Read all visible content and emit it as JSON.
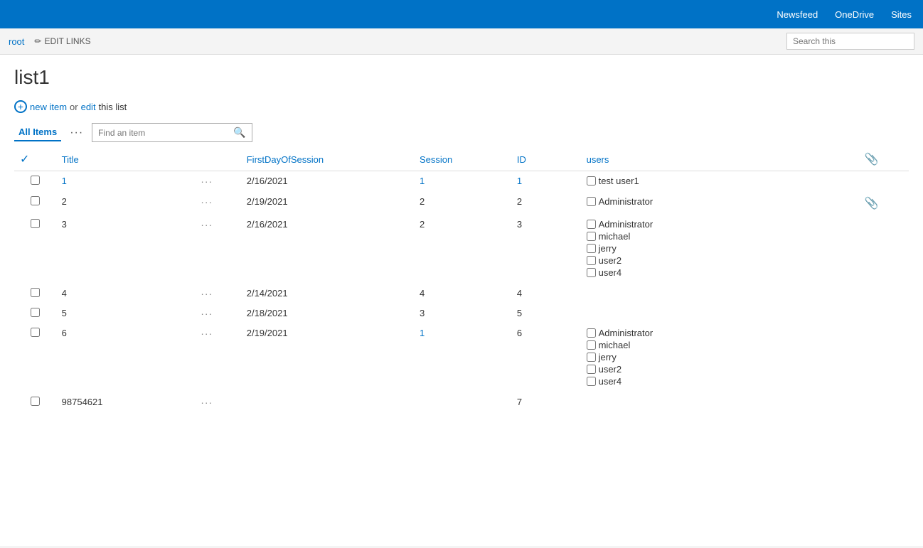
{
  "topnav": {
    "links": [
      "Newsfeed",
      "OneDrive",
      "Sites"
    ]
  },
  "subnav": {
    "breadcrumb": "root",
    "edit_links_label": "EDIT LINKS",
    "search_placeholder": "Search this"
  },
  "page": {
    "title": "list1",
    "new_item_label": "new item",
    "or_text": "or",
    "edit_label": "edit",
    "this_list_text": "this list"
  },
  "toolbar": {
    "all_items_label": "All Items",
    "ellipsis": "···",
    "find_placeholder": "Find an item",
    "search_icon": "🔍"
  },
  "table": {
    "columns": [
      "",
      "Title",
      "",
      "FirstDayOfSession",
      "Session",
      "ID",
      "users",
      "📎"
    ],
    "rows": [
      {
        "id": "1",
        "title": "1",
        "title_link": true,
        "dots": "···",
        "date": "2/16/2021",
        "session": "1",
        "session_link": true,
        "rowid": "1",
        "rowid_link": true,
        "users": [
          {
            "name": "test user1",
            "checked": false
          }
        ],
        "attach": false
      },
      {
        "id": "2",
        "title": "2",
        "title_link": false,
        "dots": "···",
        "date": "2/19/2021",
        "session": "2",
        "session_link": false,
        "rowid": "2",
        "rowid_link": false,
        "users": [
          {
            "name": "Administrator",
            "checked": false
          }
        ],
        "attach": true
      },
      {
        "id": "3",
        "title": "3",
        "title_link": false,
        "dots": "···",
        "date": "2/16/2021",
        "session": "2",
        "session_link": false,
        "rowid": "3",
        "rowid_link": false,
        "users": [
          {
            "name": "Administrator",
            "checked": false
          },
          {
            "name": "michael",
            "checked": false
          },
          {
            "name": "jerry",
            "checked": false
          },
          {
            "name": "user2",
            "checked": false
          },
          {
            "name": "user4",
            "checked": false
          }
        ],
        "attach": false
      },
      {
        "id": "4",
        "title": "4",
        "title_link": false,
        "dots": "···",
        "date": "2/14/2021",
        "session": "4",
        "session_link": false,
        "rowid": "4",
        "rowid_link": false,
        "users": [],
        "attach": false
      },
      {
        "id": "5",
        "title": "5",
        "title_link": false,
        "dots": "···",
        "date": "2/18/2021",
        "session": "3",
        "session_link": false,
        "rowid": "5",
        "rowid_link": false,
        "users": [],
        "attach": false
      },
      {
        "id": "6",
        "title": "6",
        "title_link": false,
        "dots": "···",
        "date": "2/19/2021",
        "session": "1",
        "session_link": true,
        "rowid": "6",
        "rowid_link": false,
        "users": [
          {
            "name": "Administrator",
            "checked": false
          },
          {
            "name": "michael",
            "checked": false
          },
          {
            "name": "jerry",
            "checked": false
          },
          {
            "name": "user2",
            "checked": false
          },
          {
            "name": "user4",
            "checked": false
          }
        ],
        "attach": false
      },
      {
        "id": "7",
        "title": "98754621",
        "title_link": false,
        "dots": "···",
        "date": "",
        "session": "",
        "session_link": false,
        "rowid": "7",
        "rowid_link": false,
        "users": [],
        "attach": false
      }
    ]
  }
}
